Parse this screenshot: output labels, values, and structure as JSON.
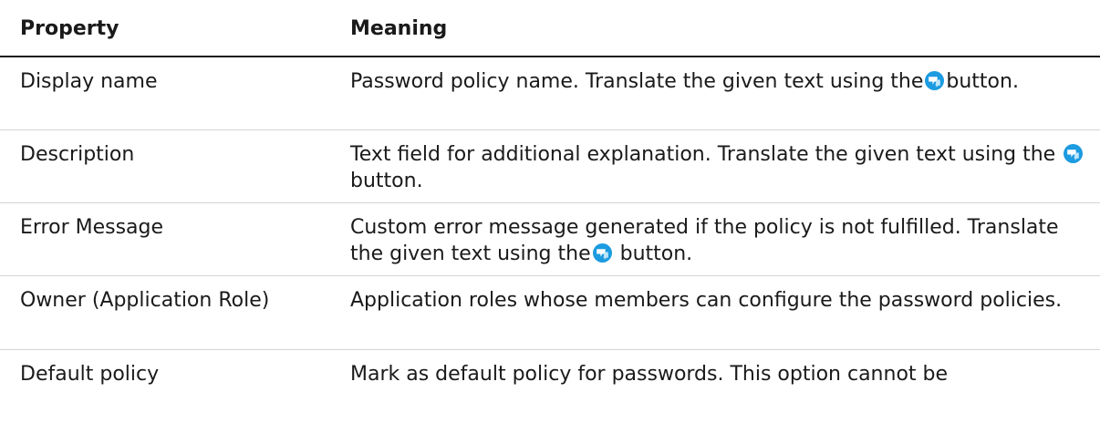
{
  "table": {
    "headers": {
      "property": "Property",
      "meaning": "Meaning"
    },
    "rows": [
      {
        "property": "Display name",
        "meaning_before": "Password policy name. Translate the given text using the",
        "icon": "translate-icon",
        "meaning_after": "button."
      },
      {
        "property": "Description",
        "meaning_before": "Text field for additional explanation. Translate the given text using the",
        "icon": "translate-icon",
        "meaning_after": "button."
      },
      {
        "property": "Error Message",
        "meaning_before": "Custom error message generated if the policy is not fulfilled. Translate the given text using the",
        "icon": "translate-icon",
        "meaning_after": "button."
      },
      {
        "property": "Owner (Application Role)",
        "meaning_before": "Application roles whose members can configure the password policies.",
        "meaning_after": ""
      },
      {
        "property": "Default policy",
        "meaning_before": "Mark as default policy for passwords. This option cannot be",
        "meaning_after": ""
      }
    ]
  },
  "colors": {
    "icon_blue": "#1c9be0",
    "header_rule": "#1a1a1a",
    "row_rule": "#d4d4d4"
  }
}
